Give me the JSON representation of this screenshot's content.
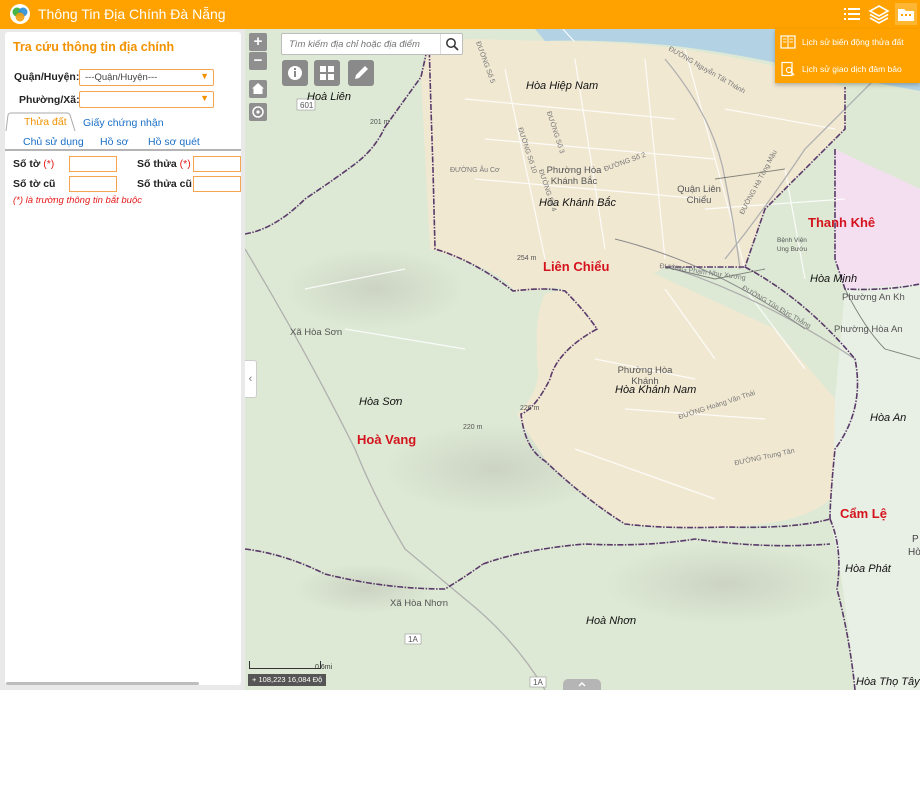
{
  "header": {
    "title": "Thông Tin Địa Chính Đà Nẵng",
    "icons": [
      "list-icon",
      "layers-icon",
      "folder-icon"
    ],
    "color": "#ffa200"
  },
  "panel": {
    "title": "Tra cứu thông tin địa chính",
    "district_label": "Quận/Huyện:",
    "district_value": "---Quận/Huyện---",
    "ward_label": "Phường/Xã:",
    "ward_value": "",
    "tabs": [
      "Thửa đất",
      "Giấy chứng nhận"
    ],
    "subtabs": [
      "Chủ sử dụng",
      "Hồ sơ",
      "Hồ sơ quét"
    ],
    "fields": {
      "so_to": "Số tờ",
      "so_thua": "Số thửa",
      "so_to_cu": "Số tờ cũ",
      "so_thua_cu": "Số thửa cũ",
      "required_mark": "(*)"
    },
    "note": "(*) là trường thông tin bắt buộc"
  },
  "map": {
    "search_placeholder": "Tìm kiếm địa chỉ hoặc địa điểm",
    "zoom_in": "+",
    "zoom_out": "−",
    "scale": "0.6mi",
    "coords": "108,223 16,084 Độ",
    "labels": {
      "districts": [
        "Liên Chiểu",
        "Thanh Khê",
        "Hoà Vang",
        "Cẩm Lệ"
      ],
      "wards": [
        "Hoà Liên",
        "Hòa Hiệp Nam",
        "Hòa Khánh Bắc",
        "Hòa Minh",
        "Hòa Khánh Nam",
        "Hòa Sơn",
        "Hòa An",
        "Hòa Phát",
        "Hoà Nhơn",
        "Hòa Thọ Tây"
      ],
      "ward_plain": [
        "Phường Hòa Khánh Bắc",
        "Quận Liên Chiểu",
        "Phường Hòa Khánh",
        "Phường An Kh",
        "Phường Hòa An",
        "Xã Hòa Sơn",
        "Xã Hòa Nhơn",
        "Bệnh Viện Ung Bướu"
      ],
      "streets": [
        "ĐƯỜNG Số 5",
        "ĐƯỜNG Số 3",
        "ĐƯỜNG Số 10",
        "ĐƯỜNG Số 2",
        "ĐƯỜNG Âu Cơ",
        "ĐƯỜNG Số 4",
        "ĐƯỜNG Phạm Như Xương",
        "ĐƯỜNG Tôn Đức Thắng",
        "ĐƯỜNG Hoàng Văn Thái",
        "ĐƯỜNG Trung Tân",
        "ĐƯỜNG Nguyễn Tất Thành",
        "ĐƯỜNG Hà Tông Mậu"
      ],
      "elevations": [
        "201 m",
        "254 m",
        "226 m",
        "220 m"
      ],
      "road_codes": [
        "601",
        "1A",
        "1A"
      ],
      "edge": [
        "P",
        "Hò"
      ]
    },
    "colors": {
      "land": "#dde9d4",
      "lien_chieu": "#f1e8d2",
      "thanh_khe": "#f4dff1",
      "sea": "#b3d3e5",
      "boundary": "#5a3a6a",
      "district_label": "#d5131d"
    }
  },
  "dropdown": {
    "items": [
      "Lịch sử biến động thửa đất",
      "Lịch sử giao dịch đảm bảo"
    ]
  }
}
